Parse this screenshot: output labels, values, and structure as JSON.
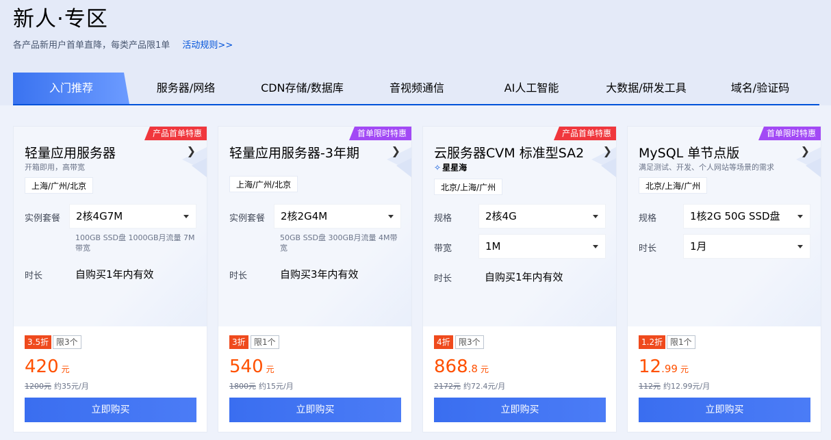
{
  "header": {
    "title": "新人·专区",
    "subtitle": "各产品新用户首单直降，每类产品限1单",
    "rules_link": "活动规则>>"
  },
  "tabs": [
    {
      "label": "入门推荐"
    },
    {
      "label": "服务器/网络"
    },
    {
      "label": "CDN存储/数据库"
    },
    {
      "label": "音视频通信"
    },
    {
      "label": "AI人工智能"
    },
    {
      "label": "大数据/研发工具"
    },
    {
      "label": "域名/验证码"
    }
  ],
  "cards": [
    {
      "badge": "产品首单特惠",
      "title": "轻量应用服务器",
      "desc": "开箱即用，高带宽",
      "region": "上海/广州/北京",
      "spec_label": "实例套餐",
      "spec_value": "2核4G7M",
      "spec_note": "100GB SSD盘 1000GB月流量 7M带宽",
      "duration_label": "时长",
      "duration_value": "自购买1年内有效",
      "discount": "3.5折",
      "limit": "限3个",
      "price_int": "420",
      "price_dec": "",
      "price_unit": "元",
      "orig_price": "1200元",
      "monthly": "约35元/月",
      "buy": "立即购买"
    },
    {
      "badge": "首单限时特惠",
      "title": "轻量应用服务器-3年期",
      "region": "上海/广州/北京",
      "spec_label": "实例套餐",
      "spec_value": "2核2G4M",
      "spec_note": "50GB SSD盘 300GB月流量 4M带宽",
      "duration_label": "时长",
      "duration_value": "自购买3年内有效",
      "discount": "3折",
      "limit": "限1个",
      "price_int": "540",
      "price_dec": "",
      "price_unit": "元",
      "orig_price": "1800元",
      "monthly": "约15元/月",
      "buy": "立即购买"
    },
    {
      "badge": "产品首单特惠",
      "title": "云服务器CVM 标准型SA2",
      "brand": "星星海",
      "region": "北京/上海/广州",
      "spec_label": "规格",
      "spec_value": "2核4G",
      "bw_label": "带宽",
      "bw_value": "1M",
      "duration_label": "时长",
      "duration_value": "自购买1年内有效",
      "discount": "4折",
      "limit": "限3个",
      "price_int": "868",
      "price_dec": ".8",
      "price_unit": "元",
      "orig_price": "2172元",
      "monthly": "约72.4元/月",
      "buy": "立即购买"
    },
    {
      "badge": "首单限时特惠",
      "title": "MySQL 单节点版",
      "desc": "满足测试、开发、个人网站等场景的需求",
      "region": "北京/上海/广州",
      "spec_label": "规格",
      "spec_value": "1核2G 50G SSD盘",
      "duration_label": "时长",
      "duration_value": "1月",
      "discount": "1.2折",
      "limit": "限1个",
      "price_int": "12",
      "price_dec": ".99",
      "price_unit": "元",
      "orig_price": "112元",
      "monthly": "约12.99元/月",
      "buy": "立即购买"
    }
  ],
  "colors": {
    "accent": "#0052d9",
    "price": "#ff5000",
    "badge_red": "#f0373d",
    "badge_purple": "#a249f5",
    "button": "#3a6ef0"
  }
}
